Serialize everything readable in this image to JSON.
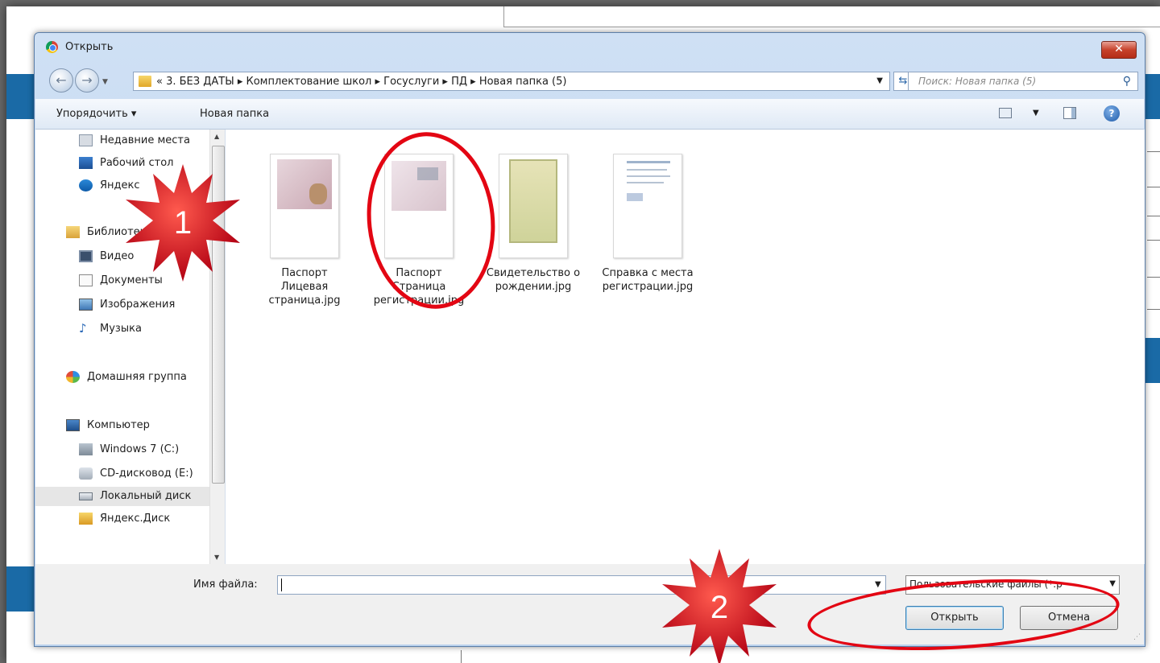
{
  "dialog": {
    "title": "Открыть",
    "close_label": "✕"
  },
  "address": {
    "path": "« 3. БЕЗ ДАТЫ  ▸  Комплектование школ  ▸  Госуслуги  ▸  ПД  ▸  Новая папка (5)"
  },
  "search": {
    "placeholder": "Поиск: Новая папка (5)"
  },
  "toolbar": {
    "organize": "Упорядочить ▾",
    "new_folder": "Новая папка"
  },
  "navpane": {
    "items": [
      {
        "label": "Недавние места",
        "icon": "recent-places-icon"
      },
      {
        "label": "Рабочий стол",
        "icon": "desktop-icon"
      },
      {
        "label": "Яндекс",
        "icon": "yandex-icon"
      },
      {
        "label": "Библиотеки",
        "icon": "libraries-icon"
      },
      {
        "label": "Видео",
        "icon": "video-icon"
      },
      {
        "label": "Документы",
        "icon": "documents-icon"
      },
      {
        "label": "Изображения",
        "icon": "images-icon"
      },
      {
        "label": "Музыка",
        "icon": "music-icon"
      },
      {
        "label": "Домашняя группа",
        "icon": "homegroup-icon"
      },
      {
        "label": "Компьютер",
        "icon": "computer-icon"
      },
      {
        "label": "Windows 7 (C:)",
        "icon": "drive-c-icon"
      },
      {
        "label": "CD-дисковод (E:)",
        "icon": "cd-drive-icon"
      },
      {
        "label": "Локальный диск",
        "icon": "local-disk-icon"
      },
      {
        "label": "Яндекс.Диск",
        "icon": "yandex-disk-icon"
      }
    ]
  },
  "files": [
    {
      "line1": "Паспорт",
      "line2": "Лицевая",
      "line3": "страница.jpg"
    },
    {
      "line1": "Паспорт",
      "line2": "Страница",
      "line3": "регистрации.jpg"
    },
    {
      "line1": "Свидетельство о",
      "line2": "рождении.jpg",
      "line3": ""
    },
    {
      "line1": "Справка с места",
      "line2": "регистрации.jpg",
      "line3": ""
    }
  ],
  "bottom": {
    "filename_label": "Имя файла:",
    "filename_value": "",
    "filter": "Пользовательские файлы (*.p",
    "open_label": "Открыть",
    "cancel_label": "Отмена"
  },
  "annotations": {
    "star1": "1",
    "star2": "2",
    "color": "#e30613"
  }
}
